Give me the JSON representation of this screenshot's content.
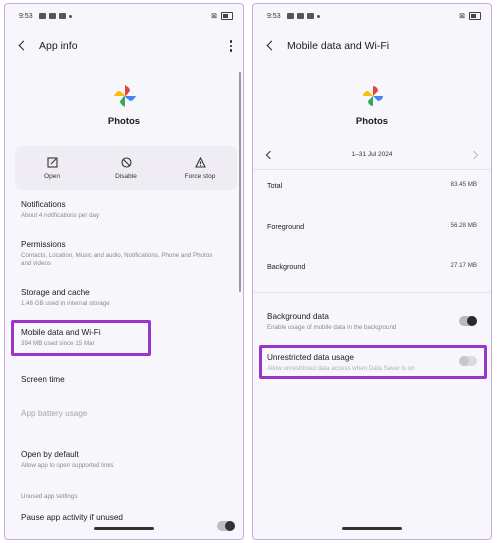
{
  "left": {
    "status_time": "9:53",
    "title": "App info",
    "app_name": "Photos",
    "actions": [
      {
        "label": "Open",
        "icon": "open-icon"
      },
      {
        "label": "Disable",
        "icon": "disable-icon"
      },
      {
        "label": "Force stop",
        "icon": "warning-icon"
      }
    ],
    "items": [
      {
        "title": "Notifications",
        "sub": "About 4 notifications per day"
      },
      {
        "title": "Permissions",
        "sub": "Contacts, Location, Music and audio, Notifications, Phone and Photos and videos"
      },
      {
        "title": "Storage and cache",
        "sub": "1.46 GB used in internal storage"
      },
      {
        "title": "Mobile data and Wi-Fi",
        "sub": "394 MB used since 15 Mar"
      },
      {
        "title": "Screen time",
        "sub": ""
      },
      {
        "title": "App battery usage",
        "sub": ""
      },
      {
        "title": "Open by default",
        "sub": "Allow app to open supported links"
      },
      {
        "title": "Pause app activity if unused",
        "sub": ""
      }
    ],
    "section_label": "Unused app settings"
  },
  "right": {
    "status_time": "9:53",
    "title": "Mobile data and Wi-Fi",
    "app_name": "Photos",
    "date_range": "1–31 Jul 2024",
    "stats": [
      {
        "label": "Total",
        "value": "83.45 MB"
      },
      {
        "label": "Foreground",
        "value": "56.28 MB"
      },
      {
        "label": "Background",
        "value": "27.17 MB"
      }
    ],
    "background_data": {
      "title": "Background data",
      "sub": "Enable usage of mobile data in the background",
      "on": true
    },
    "unrestricted": {
      "title": "Unrestricted data usage",
      "sub": "Allow unrestricted data access when Data Saver is on",
      "on": false
    }
  },
  "colors": {
    "highlight": "#9b34c8",
    "frame": "#c9a6e6"
  }
}
